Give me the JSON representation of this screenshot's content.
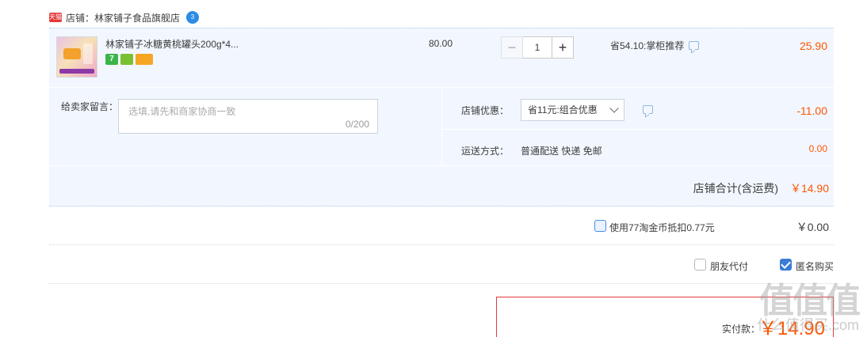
{
  "shop": {
    "tmall_badge": "天猫",
    "name": "店铺：林家铺子食品旗舰店",
    "ww_badge": "3"
  },
  "item": {
    "title": "林家铺子冰糖黄桃罐头200g*4...",
    "badges": [
      "7",
      "",
      ""
    ],
    "price": "80.00",
    "quantity": "1",
    "qty_minus": "−",
    "qty_plus": "+",
    "promo": "省54.10:掌柜推荐",
    "line_total": "25.90"
  },
  "message": {
    "label": "给卖家留言：",
    "placeholder": "选填,请先和商家协商一致",
    "counter": "0/200"
  },
  "discount": {
    "label": "店铺优惠：",
    "selected": "省11元:组合优惠",
    "value": "-11.00"
  },
  "shipping": {
    "label": "运送方式：",
    "method": "普通配送 快递 免邮",
    "value": "0.00"
  },
  "shop_total": {
    "label": "店铺合计(含运费)",
    "value": "￥14.90"
  },
  "coins": {
    "text": "使用77淘金币抵扣0.77元",
    "value": "￥0.00"
  },
  "options": {
    "friend_pay": "朋友代付",
    "anonymous": "匿名购买"
  },
  "payment": {
    "label": "实付款：",
    "value": "￥14.90"
  },
  "watermark": {
    "text": "值值值",
    "sub": "什么值得买.com"
  },
  "colors": {
    "accent": "#ff5500",
    "row_bg": "#f2f7ff",
    "border_red": "#e4393c",
    "check_blue": "#3a7bd5"
  }
}
